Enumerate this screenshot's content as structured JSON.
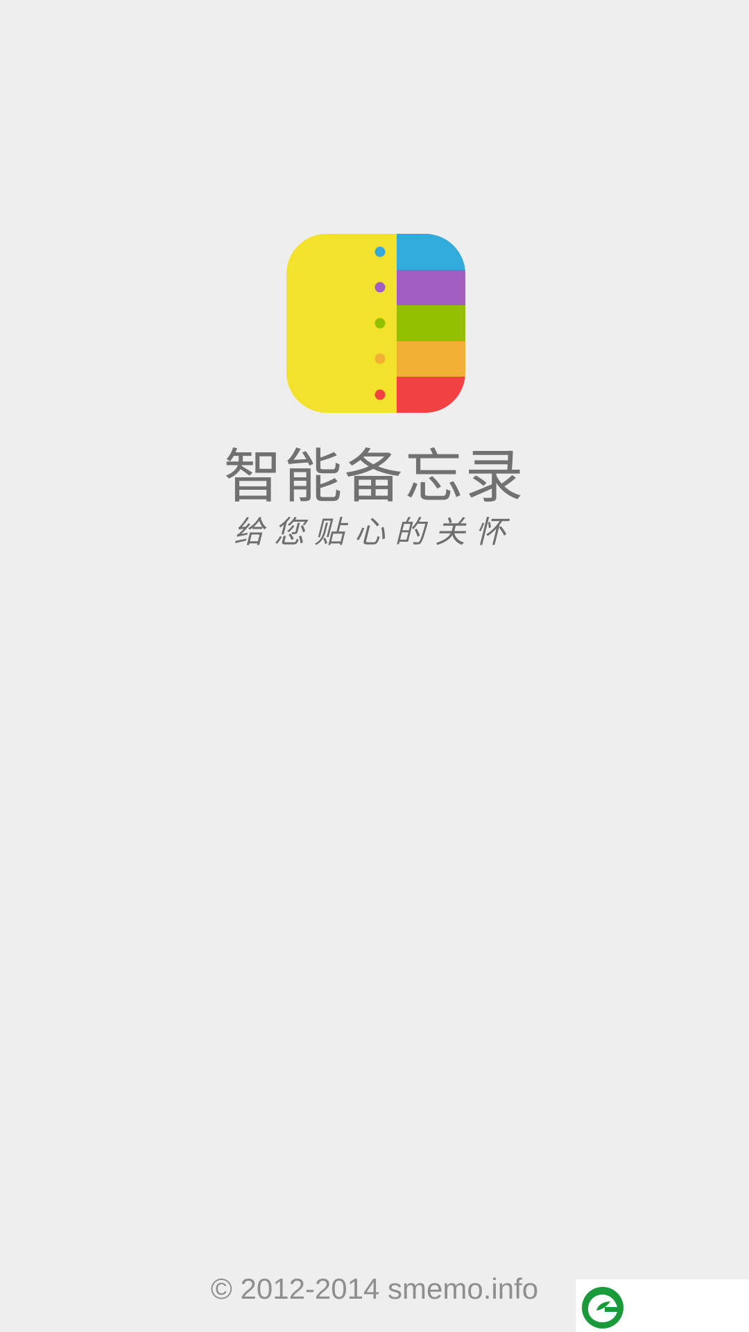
{
  "app": {
    "title": "智能备忘录",
    "slogan": "给您贴心的关怀",
    "copyright": "© 2012-2014 smemo.info"
  },
  "icons": {
    "app_logo": "notebook-tabs-icon",
    "badge_logo": "green-leaf-logo-icon"
  },
  "colors": {
    "background": "#eeeeee",
    "notebook_yellow": "#f2e22c",
    "tab_blue": "#32aadb",
    "tab_purple": "#a25ec0",
    "tab_green": "#93c000",
    "tab_orange": "#f2b034",
    "tab_red": "#f24142",
    "text_gray": "#717171",
    "badge_green": "#1a9a3a"
  }
}
